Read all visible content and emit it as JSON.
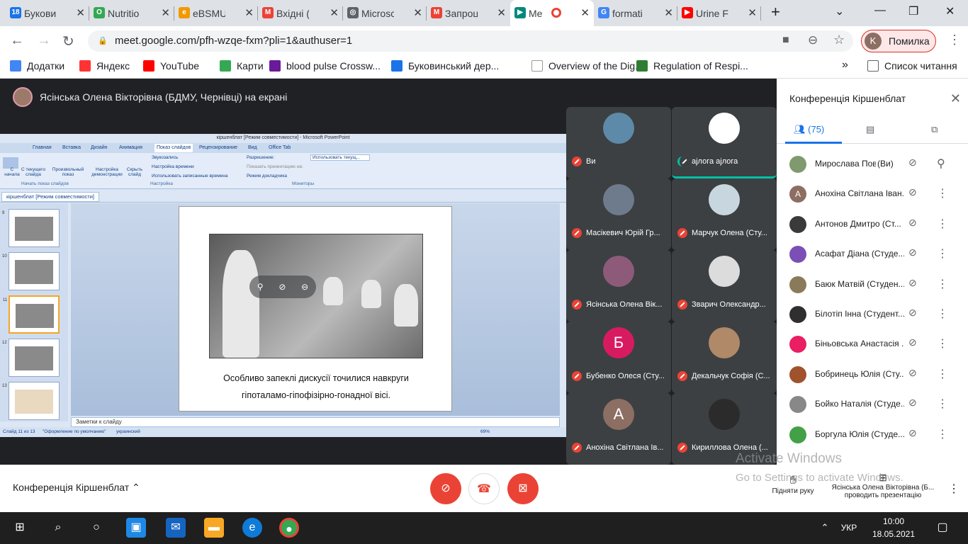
{
  "browser": {
    "tabs": [
      {
        "title": "Букови",
        "color": "#1a73e8",
        "glyph": "18"
      },
      {
        "title": "Nutritio",
        "color": "#34a853",
        "glyph": "O"
      },
      {
        "title": "eBSMU",
        "color": "#f29900",
        "glyph": "e"
      },
      {
        "title": "Вхідні (",
        "color": "#ea4335",
        "glyph": "M"
      },
      {
        "title": "Microsc",
        "color": "#5f6368",
        "glyph": "◎"
      },
      {
        "title": "Запроц",
        "color": "#ea4335",
        "glyph": "M"
      },
      {
        "title": "Me",
        "color": "#00897b",
        "glyph": "▶"
      },
      {
        "title": "formati",
        "color": "#4285f4",
        "glyph": "G"
      },
      {
        "title": "Urine Fc",
        "color": "#ff0000",
        "glyph": "▶"
      }
    ],
    "url": "meet.google.com/pfh-wzqe-fxm?pli=1&authuser=1",
    "profile_initial": "K",
    "profile_label": "Помилка",
    "bookmarks": [
      {
        "label": "Додатки",
        "color": "#4285f4"
      },
      {
        "label": "Яндекс",
        "color": "#ff3333"
      },
      {
        "label": "YouTube",
        "color": "#ff0000"
      },
      {
        "label": "Карти",
        "color": "#34a853"
      },
      {
        "label": "blood pulse Crossw...",
        "color": "#6a1b9a"
      },
      {
        "label": "Буковинський дер...",
        "color": "#1a73e8"
      },
      {
        "label": "Overview of the Dig...",
        "color": "#ffffff"
      },
      {
        "label": "Regulation of Respi...",
        "color": "#2e7d32"
      }
    ],
    "reading_list": "Список читання"
  },
  "meet": {
    "presenter_text": "Ясінська Олена Вікторівна (БДМУ, Чернівці) на екрані",
    "panel_title": "Конференція Кіршенблат",
    "participant_count": "(75)",
    "meeting_title": "Конференція Кіршенблат",
    "raise_hand": "Підняти руку",
    "presenter_action_line1": "Ясінська Олена Вікторівна (Б...",
    "presenter_action_line2": "проводить презентацію",
    "watermark_line1": "Activate Windows",
    "watermark_line2": "Go to Settings to activate Windows."
  },
  "ppt": {
    "title": "кіршенблат [Режим совместимости] - Microsoft PowerPoint",
    "tabs": [
      "Главная",
      "Вставка",
      "Дизайн",
      "Анимация",
      "Показ слайдов",
      "Рецензирование",
      "Вид",
      "Office Tab"
    ],
    "ribbon": {
      "from_start": "С начала",
      "from_current": "С текущего слайда",
      "custom": "Произвольный показ",
      "setup": "Настройка демонстрации",
      "hide": "Скрыть слайд",
      "record": "Звукозапись",
      "timing": "Настройка времени",
      "use_timing": "Использовать записанные времена",
      "resolution": "Разрешение:",
      "resolution_value": "Использовать текущ...",
      "show_on": "Показать презентацию на:",
      "presenter_mode": "Режим докладчика",
      "group1": "Начать показ слайдов",
      "group2": "Настройка",
      "group3": "Мониторы"
    },
    "doc_tab": "кіршенблат [Режим совместимости]",
    "thumb_numbers": [
      "9",
      "10",
      "11",
      "12",
      "13"
    ],
    "caption_line1": "Особливо запеклі дискусії точилися навкруги",
    "caption_line2": "гіпоталамо-гіпофізірно-гонадної  вісі.",
    "notes": "Заметки к слайду",
    "status_slide": "Слайд 11 из 13",
    "status_theme": "\"Оформление по умолчанию\"",
    "status_lang": "украинский",
    "zoom": "69%"
  },
  "tiles": [
    {
      "name": "Ви",
      "initial": "",
      "color": "#5d8aa8"
    },
    {
      "name": "ajлога ajлога",
      "initial": "",
      "color": "#ffffff"
    },
    {
      "name": "Масікевич Юрій Гр...",
      "initial": "",
      "color": "#6d7b8d"
    },
    {
      "name": "Марчук Олена (Сту...",
      "initial": "",
      "color": "#c8d6e0"
    },
    {
      "name": "Ясінська Олена Вік...",
      "initial": "",
      "color": "#8e5a7a"
    },
    {
      "name": "Зварич Олександр...",
      "initial": "",
      "color": "#dcdcdc"
    },
    {
      "name": "Бубенко Олеся (Сту...",
      "initial": "Б",
      "color": "#d81b60"
    },
    {
      "name": "Декальчук Софія (С...",
      "initial": "",
      "color": "#b08968"
    },
    {
      "name": "Анохіна Світлана Ів...",
      "initial": "А",
      "color": "#8d6e63"
    },
    {
      "name": "Кириллова Олена (...",
      "initial": "",
      "color": "#2b2b2b"
    }
  ],
  "participants": [
    {
      "name": "Мирослава Пов...",
      "you": "(Ви)",
      "initial": "",
      "color": "#7e9a6e"
    },
    {
      "name": "Анохіна Світлана Іван...",
      "initial": "А",
      "color": "#8d6e63"
    },
    {
      "name": "Антонов Дмитро (Ст...",
      "initial": "",
      "color": "#3a3a3a"
    },
    {
      "name": "Асафат Діана (Студе...",
      "initial": "",
      "color": "#7b4fb5"
    },
    {
      "name": "Баюк Матвій (Студен...",
      "initial": "",
      "color": "#8a7a5a"
    },
    {
      "name": "Білотіп Інна (Студент...",
      "initial": "",
      "color": "#2f2f2f"
    },
    {
      "name": "Біньовська Анастасія ...",
      "initial": "",
      "color": "#e91e63"
    },
    {
      "name": "Бобринець Юлія (Сту...",
      "initial": "",
      "color": "#a0522d"
    },
    {
      "name": "Бойко Наталія (Студе...",
      "initial": "",
      "color": "#888888"
    },
    {
      "name": "Боргула Юлія (Студе...",
      "initial": "",
      "color": "#43a047"
    }
  ],
  "taskbar": {
    "lang": "УКР",
    "time": "10:00",
    "date": "18.05.2021"
  }
}
